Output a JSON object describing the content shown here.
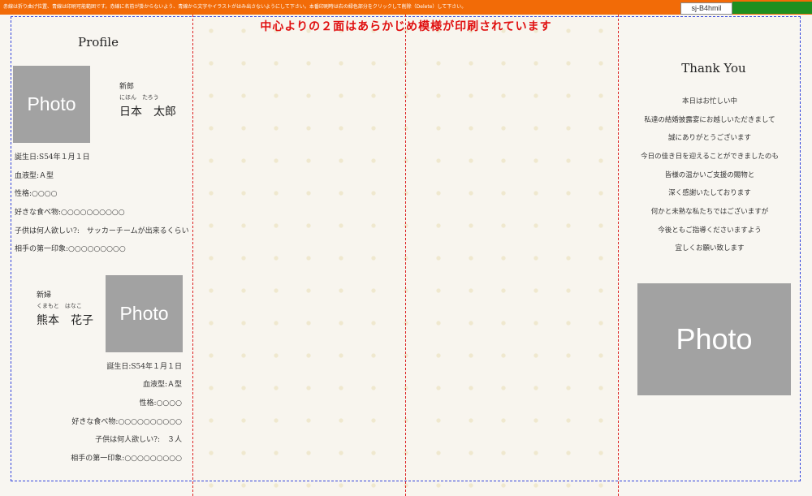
{
  "header": {
    "instructions": "赤線は折り曲げ位置、青線は印刷可能範囲です。赤線に名前が掛からないよう、青線から文字やイラストがはみ出さないようにして下さい。本番印刷時は右の緑色部分をクリックして削除（Delete）して下さい。",
    "template_code": "sj-B4hmil"
  },
  "notice": "中心よりの２面はあらかじめ模様が印刷されています",
  "profile": {
    "title": "Profile",
    "photo_label": "Photo",
    "groom": {
      "role": "新郎",
      "reading": "にほん　たろう",
      "name": "日本　太郎",
      "details": [
        "誕生日:S54年１月１日",
        "血液型:Ａ型",
        "性格:○○○○",
        "好きな食べ物:○○○○○○○○○○",
        "子供は何人欲しい?:　サッカーチームが出来るくらい",
        "相手の第一印象:○○○○○○○○○"
      ]
    },
    "bride": {
      "role": "新婦",
      "reading": "くまもと　はなこ",
      "name": "熊本　花子",
      "details": [
        "誕生日:S54年１月１日",
        "血液型:Ａ型",
        "性格:○○○○",
        "好きな食べ物:○○○○○○○○○○",
        "子供は何人欲しい?:　３人",
        "相手の第一印象:○○○○○○○○○"
      ]
    }
  },
  "thankyou": {
    "title": "Thank You",
    "lines": [
      "本日はお忙しい中",
      "私達の結婚披露宴にお越しいただきまして",
      "誠にありがとうございます",
      "今日の佳き日を迎えることができましたのも",
      "皆様の温かいご支援の賜物と",
      "深く感謝いたしております",
      "何かと未熟な私たちではございますが",
      "今後ともご指導くださいますよう",
      "宜しくお願い致します"
    ],
    "photo_label": "Photo"
  }
}
